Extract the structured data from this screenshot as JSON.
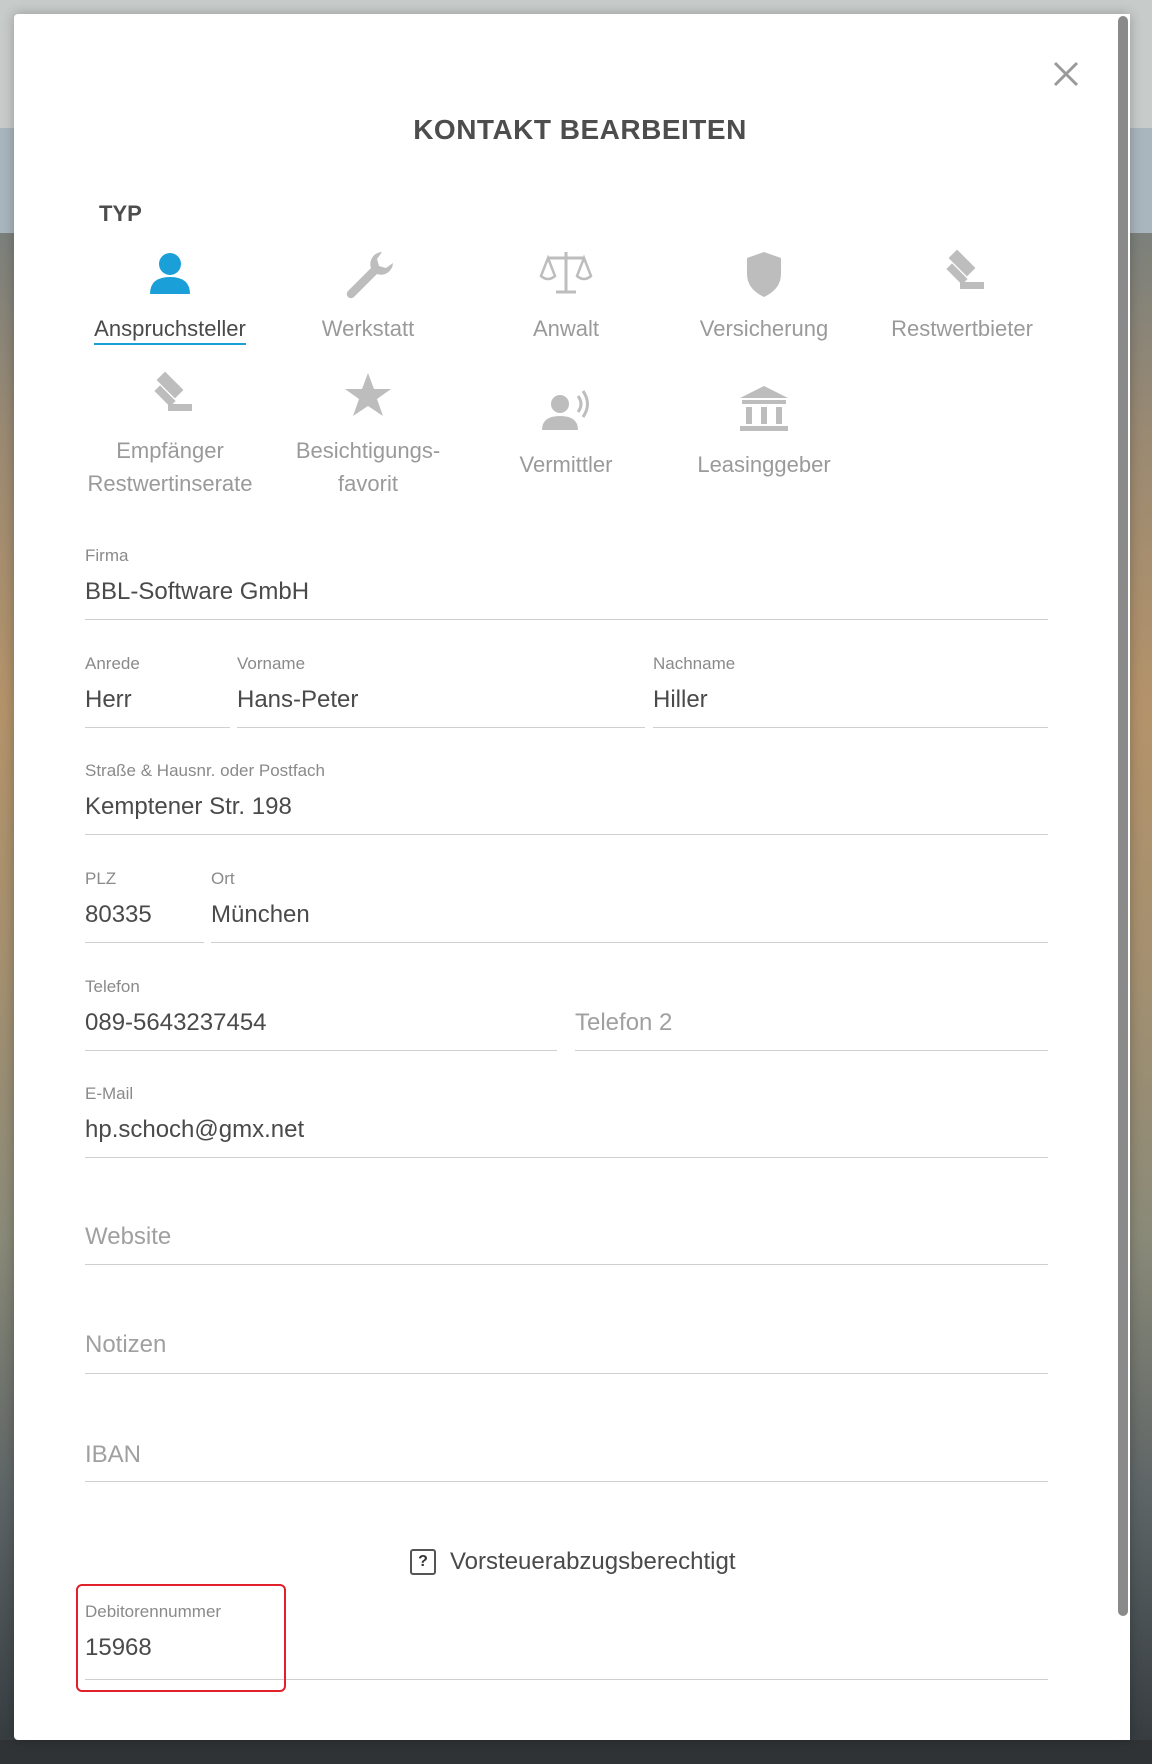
{
  "dialog": {
    "title": "KONTAKT BEARBEITEN",
    "close_icon": "close-icon"
  },
  "type_section": {
    "label": "TYP",
    "types": [
      {
        "label": "Anspruchsteller",
        "icon": "person-icon",
        "active": true
      },
      {
        "label": "Werkstatt",
        "icon": "wrench-icon",
        "active": false
      },
      {
        "label": "Anwalt",
        "icon": "scales-icon",
        "active": false
      },
      {
        "label": "Versicherung",
        "icon": "shield-icon",
        "active": false
      },
      {
        "label": "Restwertbieter",
        "icon": "gavel-icon",
        "active": false
      },
      {
        "label_line1": "Empfänger",
        "label_line2": "Restwertinserate",
        "icon": "gavel-icon",
        "active": false
      },
      {
        "label_line1": "Besichtigungs-",
        "label_line2": "favorit",
        "icon": "star-icon",
        "active": false
      },
      {
        "label": "Vermittler",
        "icon": "speaker-person-icon",
        "active": false
      },
      {
        "label": "Leasinggeber",
        "icon": "bank-icon",
        "active": false
      }
    ],
    "active_color": "#1a9fd9",
    "inactive_color": "#bdbdbd"
  },
  "form": {
    "firma": {
      "label": "Firma",
      "value": "BBL-Software GmbH"
    },
    "anrede": {
      "label": "Anrede",
      "value": "Herr"
    },
    "vorname": {
      "label": "Vorname",
      "value": "Hans-Peter"
    },
    "nachname": {
      "label": "Nachname",
      "value": "Hiller"
    },
    "strasse": {
      "label": "Straße & Hausnr. oder Postfach",
      "value": "Kemptener Str. 198"
    },
    "plz": {
      "label": "PLZ",
      "value": "80335"
    },
    "ort": {
      "label": "Ort",
      "value": "München"
    },
    "telefon": {
      "label": "Telefon",
      "value": "089-5643237454"
    },
    "telefon2": {
      "placeholder": "Telefon 2"
    },
    "email": {
      "label": "E-Mail",
      "value": "hp.schoch@gmx.net"
    },
    "website": {
      "placeholder": "Website"
    },
    "notizen": {
      "placeholder": "Notizen"
    },
    "iban": {
      "placeholder": "IBAN"
    },
    "vorsteuer": {
      "label": "Vorsteuerabzugsberechtigt",
      "state_glyph": "?"
    },
    "debitorennummer": {
      "label": "Debitorennummer",
      "value": "15968"
    }
  },
  "highlight_color": "#e0202a"
}
